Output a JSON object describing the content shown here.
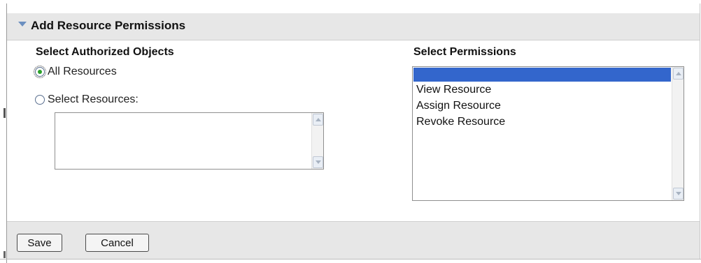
{
  "panel": {
    "title": "Add Resource Permissions"
  },
  "objects": {
    "heading": "Select Authorized Objects",
    "options": [
      {
        "label": "All Resources",
        "checked": true
      },
      {
        "label": "Select Resources:",
        "checked": false
      }
    ],
    "resources_list": []
  },
  "permissions": {
    "heading": "Select Permissions",
    "items": [
      {
        "label": "",
        "selected": true
      },
      {
        "label": "View Resource",
        "selected": false
      },
      {
        "label": "Assign Resource",
        "selected": false
      },
      {
        "label": "Revoke Resource",
        "selected": false
      }
    ]
  },
  "footer": {
    "save_label": "Save",
    "cancel_label": "Cancel"
  },
  "colors": {
    "header_bg": "#e7e7e7",
    "selection": "#3366cc",
    "radio_dot": "#2aa12a",
    "arrow": "#6b8fc0"
  }
}
